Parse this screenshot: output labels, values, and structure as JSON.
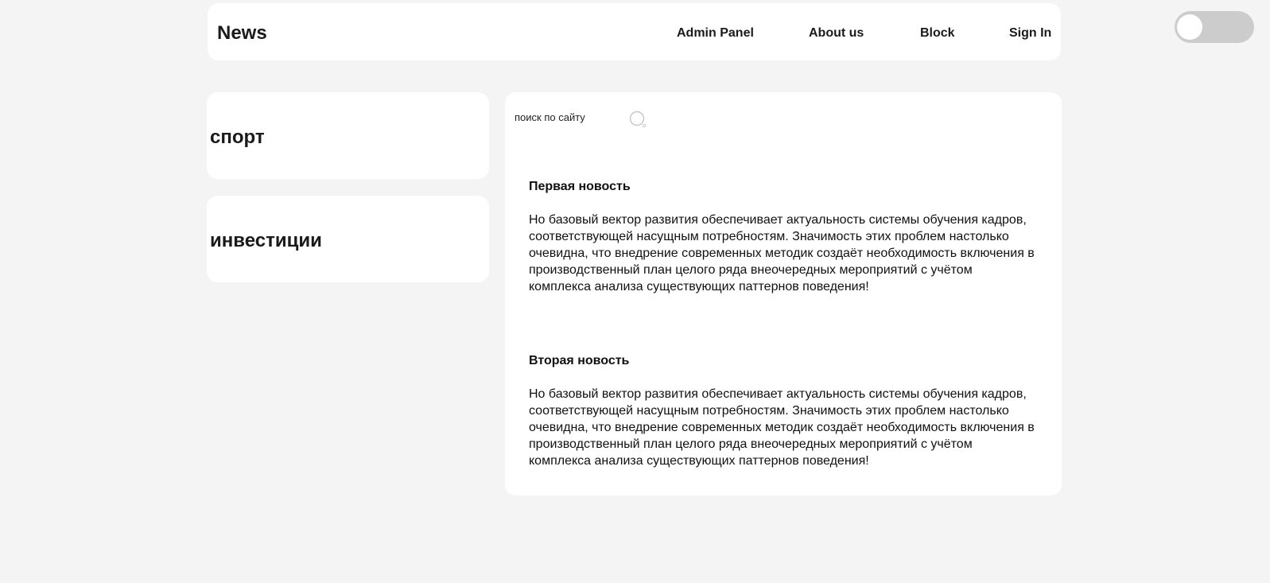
{
  "header": {
    "brand": "News",
    "nav": [
      "Admin Panel",
      "About us",
      "Block",
      "Sign In"
    ]
  },
  "theme_toggle": {
    "on": false
  },
  "categories": [
    "спорт",
    "инвестиции"
  ],
  "search": {
    "placeholder": "поиск по сайту"
  },
  "news": [
    {
      "title": "Первая новость",
      "body": "Но базовый вектор развития обеспечивает актуальность системы обучения кадров, соответствующей насущным потребностям. Значимость этих проблем настолько очевидна, что внедрение современных методик создаёт необходимость включения в производственный план целого ряда внеочередных мероприятий с учётом комплекса анализа существующих паттернов поведения!"
    },
    {
      "title": "Вторая новость",
      "body": "Но базовый вектор развития обеспечивает актуальность системы обучения кадров, соответствующей насущным потребностям. Значимость этих проблем настолько очевидна, что внедрение современных методик создаёт необходимость включения в производственный план целого ряда внеочередных мероприятий с учётом комплекса анализа существующих паттернов поведения!"
    }
  ],
  "colors": {
    "page_background": "#f4f4f4",
    "card_background": "#ffffff",
    "toggle_track": "#cccccc",
    "text": "#111111"
  }
}
